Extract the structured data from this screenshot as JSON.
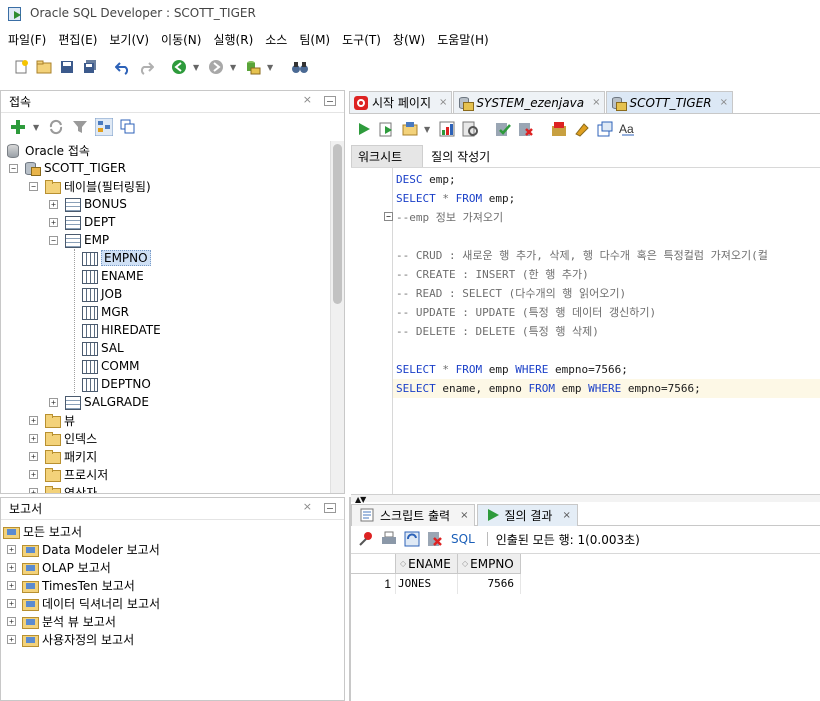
{
  "window": {
    "title": "Oracle SQL Developer : SCOTT_TIGER"
  },
  "menu": [
    "파일(F)",
    "편집(E)",
    "보기(V)",
    "이동(N)",
    "실행(R)",
    "소스",
    "팀(M)",
    "도구(T)",
    "창(W)",
    "도움말(H)"
  ],
  "connections_panel": {
    "title": "접속",
    "close": "×",
    "tree": [
      {
        "label": "Oracle 접속",
        "icon": "database-icon",
        "expander": "",
        "level": 0
      },
      {
        "label": "SCOTT_TIGER",
        "icon": "connection-icon",
        "expander": "−",
        "level": 1
      },
      {
        "label": "테이블(필터링됨)",
        "icon": "folder-icon",
        "expander": "−",
        "level": 2
      },
      {
        "label": "BONUS",
        "icon": "table-icon",
        "expander": "+",
        "level": 3
      },
      {
        "label": "DEPT",
        "icon": "table-icon",
        "expander": "+",
        "level": 3
      },
      {
        "label": "EMP",
        "icon": "table-icon",
        "expander": "−",
        "level": 3
      },
      {
        "label": "EMPNO",
        "icon": "column-icon",
        "expander": "",
        "level": 4,
        "selected": true
      },
      {
        "label": "ENAME",
        "icon": "column-icon",
        "expander": "",
        "level": 4
      },
      {
        "label": "JOB",
        "icon": "column-icon",
        "expander": "",
        "level": 4
      },
      {
        "label": "MGR",
        "icon": "column-icon",
        "expander": "",
        "level": 4
      },
      {
        "label": "HIREDATE",
        "icon": "column-icon",
        "expander": "",
        "level": 4
      },
      {
        "label": "SAL",
        "icon": "column-icon",
        "expander": "",
        "level": 4
      },
      {
        "label": "COMM",
        "icon": "column-icon",
        "expander": "",
        "level": 4
      },
      {
        "label": "DEPTNO",
        "icon": "column-icon",
        "expander": "",
        "level": 4
      },
      {
        "label": "SALGRADE",
        "icon": "table-icon",
        "expander": "+",
        "level": 3
      },
      {
        "label": "뷰",
        "icon": "folder-icon",
        "expander": "+",
        "level": 2
      },
      {
        "label": "인덱스",
        "icon": "folder-icon",
        "expander": "+",
        "level": 2
      },
      {
        "label": "패키지",
        "icon": "folder-icon",
        "expander": "+",
        "level": 2
      },
      {
        "label": "프로시저",
        "icon": "folder-icon",
        "expander": "+",
        "level": 2
      },
      {
        "label": "연산자",
        "icon": "folder-icon",
        "expander": "+",
        "level": 2
      }
    ]
  },
  "reports_panel": {
    "title": "보고서",
    "close": "×",
    "tree": [
      {
        "label": "모든 보고서",
        "expander": "",
        "level": 0
      },
      {
        "label": "Data Modeler 보고서",
        "expander": "+",
        "level": 1
      },
      {
        "label": "OLAP 보고서",
        "expander": "+",
        "level": 1
      },
      {
        "label": "TimesTen 보고서",
        "expander": "+",
        "level": 1
      },
      {
        "label": "데이터 딕셔너리 보고서",
        "expander": "+",
        "level": 1
      },
      {
        "label": "분석 뷰 보고서",
        "expander": "+",
        "level": 1
      },
      {
        "label": "사용자정의 보고서",
        "expander": "+",
        "level": 1
      }
    ]
  },
  "editor_tabs": [
    {
      "label": "시작 페이지",
      "close": "×",
      "icon": "start-page-icon",
      "italic": false
    },
    {
      "label": "SYSTEM_ezenjava",
      "close": "×",
      "icon": "sql-connection-icon",
      "italic": true
    },
    {
      "label": "SCOTT_TIGER",
      "close": "×",
      "icon": "sql-connection-icon",
      "italic": true,
      "active": true
    }
  ],
  "sub_tabs": {
    "worksheet": "워크시트",
    "query_builder": "질의 작성기"
  },
  "code_lines": [
    [
      [
        "kw",
        "DESC"
      ],
      [
        "",
        " emp;"
      ]
    ],
    [
      [
        "kw",
        "SELECT"
      ],
      [
        "",
        " "
      ],
      [
        "cmt",
        "*"
      ],
      [
        "",
        " "
      ],
      [
        "kw",
        "FROM"
      ],
      [
        "",
        " emp;"
      ]
    ],
    [
      [
        "cmt",
        "--emp 정보 가져오기"
      ]
    ],
    [],
    [
      [
        "cmt",
        "-- CRUD : 새로운 행 추가, 삭제, 행 다수개 혹은 특정컬럼 가져오기(컬"
      ]
    ],
    [
      [
        "cmt",
        "-- CREATE : INSERT (한 행 추가)"
      ]
    ],
    [
      [
        "cmt",
        "-- READ : SELECT (다수개의 행 읽어오기)"
      ]
    ],
    [
      [
        "cmt",
        "-- UPDATE : UPDATE (특정 행 데이터 갱신하기)"
      ]
    ],
    [
      [
        "cmt",
        "-- DELETE : DELETE (특정 행 삭제)"
      ]
    ],
    [],
    [
      [
        "kw",
        "SELECT"
      ],
      [
        "",
        " "
      ],
      [
        "cmt",
        "*"
      ],
      [
        "",
        " "
      ],
      [
        "kw",
        "FROM"
      ],
      [
        "",
        " emp "
      ],
      [
        "kw",
        "WHERE"
      ],
      [
        "",
        " empno=7566;"
      ]
    ],
    [
      [
        "kw",
        "SELECT"
      ],
      [
        "",
        " ename, empno "
      ],
      [
        "kw",
        "FROM"
      ],
      [
        "",
        " emp "
      ],
      [
        "kw",
        "WHERE"
      ],
      [
        "",
        " empno=7566;"
      ]
    ]
  ],
  "results": {
    "tabs": [
      {
        "label": "스크립트 출력",
        "close": "×"
      },
      {
        "label": "질의 결과",
        "close": "×",
        "active": true
      }
    ],
    "sql_link": "SQL",
    "status": "인출된 모든 행: 1(0.003초)",
    "columns": [
      "ENAME",
      "EMPNO"
    ],
    "rows": [
      {
        "num": "1",
        "ENAME": "JONES",
        "EMPNO": "7566"
      }
    ]
  },
  "colors": {
    "keyword": "#1a3fc8",
    "comment": "#6e6e6e",
    "current_line": "#fdf8e6",
    "selection": "#cfe0f5"
  }
}
